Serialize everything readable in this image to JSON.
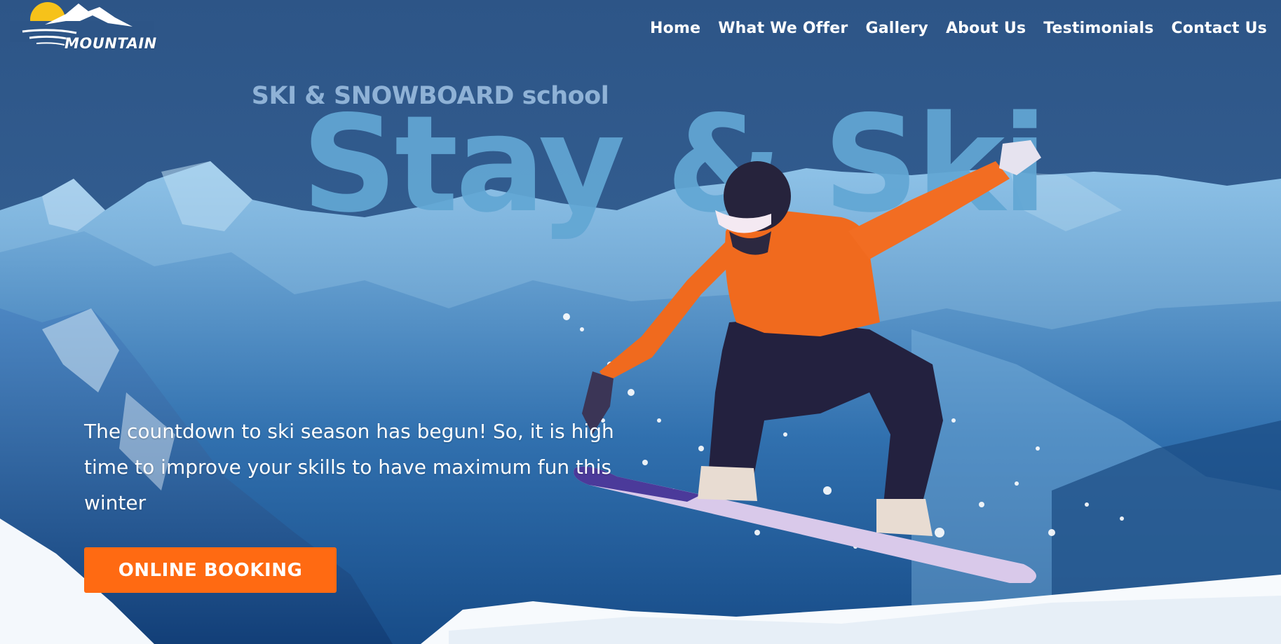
{
  "brand": {
    "name": "MOUNTAIN"
  },
  "nav": {
    "items": [
      "Home",
      "What We Offer",
      "Gallery",
      "About Us",
      "Testimonials",
      "Contact Us"
    ]
  },
  "hero": {
    "subtitle": "SKI & SNOWBOARD school",
    "title": "Stay & Ski",
    "description": "The countdown to ski season has begun! So, it is high time to improve your skills to have maximum fun this winter",
    "cta_label": "ONLINE BOOKING"
  },
  "colors": {
    "sky": "#2f5a8e",
    "title": "#62a7d4",
    "accent": "#ff6a12",
    "jacket": "#f06a1e"
  }
}
